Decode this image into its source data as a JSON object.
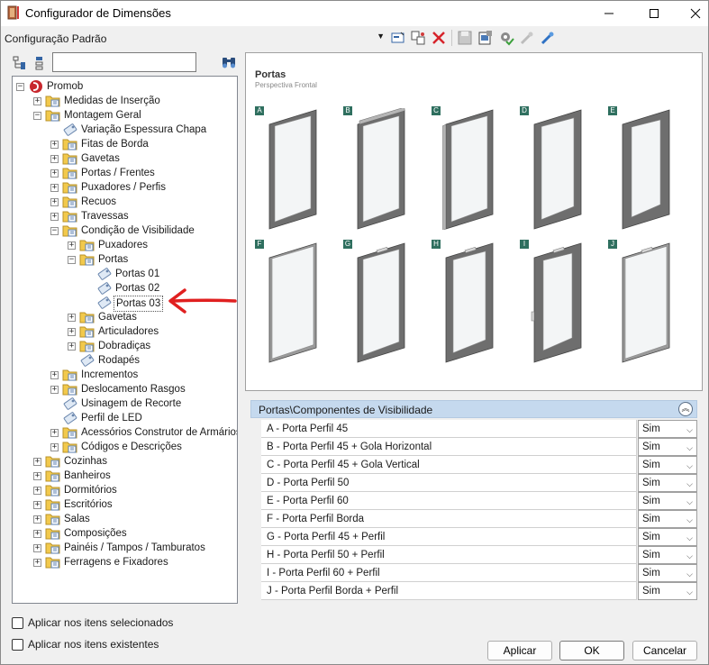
{
  "window": {
    "title": "Configurador de Dimensões"
  },
  "toolbar": {
    "config_value": "Configuração Padrão"
  },
  "search": {
    "placeholder": ""
  },
  "tree": [
    {
      "label": "Promob",
      "level": 0,
      "exp": "-",
      "icon": "root"
    },
    {
      "label": "Medidas de Inserção",
      "level": 1,
      "exp": "+",
      "icon": "folder"
    },
    {
      "label": "Montagem Geral",
      "level": 1,
      "exp": "-",
      "icon": "folder"
    },
    {
      "label": "Variação Espessura Chapa",
      "level": 2,
      "exp": "",
      "icon": "leaf"
    },
    {
      "label": "Fitas de Borda",
      "level": 2,
      "exp": "+",
      "icon": "folder"
    },
    {
      "label": "Gavetas",
      "level": 2,
      "exp": "+",
      "icon": "folder"
    },
    {
      "label": "Portas / Frentes",
      "level": 2,
      "exp": "+",
      "icon": "folder"
    },
    {
      "label": "Puxadores / Perfis",
      "level": 2,
      "exp": "+",
      "icon": "folder"
    },
    {
      "label": "Recuos",
      "level": 2,
      "exp": "+",
      "icon": "folder"
    },
    {
      "label": "Travessas",
      "level": 2,
      "exp": "+",
      "icon": "folder"
    },
    {
      "label": "Condição de Visibilidade",
      "level": 2,
      "exp": "-",
      "icon": "folder"
    },
    {
      "label": "Puxadores",
      "level": 3,
      "exp": "+",
      "icon": "folder"
    },
    {
      "label": "Portas",
      "level": 3,
      "exp": "-",
      "icon": "folder"
    },
    {
      "label": "Portas 01",
      "level": 4,
      "exp": "",
      "icon": "leaf"
    },
    {
      "label": "Portas 02",
      "level": 4,
      "exp": "",
      "icon": "leaf"
    },
    {
      "label": "Portas 03",
      "level": 4,
      "exp": "",
      "icon": "leaf",
      "selected": true
    },
    {
      "label": "Gavetas",
      "level": 3,
      "exp": "+",
      "icon": "folder"
    },
    {
      "label": "Articuladores",
      "level": 3,
      "exp": "+",
      "icon": "folder"
    },
    {
      "label": "Dobradiças",
      "level": 3,
      "exp": "+",
      "icon": "folder"
    },
    {
      "label": "Rodapés",
      "level": 3,
      "exp": "",
      "icon": "leaf"
    },
    {
      "label": "Incrementos",
      "level": 2,
      "exp": "+",
      "icon": "folder"
    },
    {
      "label": "Deslocamento Rasgos",
      "level": 2,
      "exp": "+",
      "icon": "folder"
    },
    {
      "label": "Usinagem de Recorte",
      "level": 2,
      "exp": "",
      "icon": "leaf"
    },
    {
      "label": "Perfil de LED",
      "level": 2,
      "exp": "",
      "icon": "leaf"
    },
    {
      "label": "Acessórios Construtor de Armários",
      "level": 2,
      "exp": "+",
      "icon": "folder"
    },
    {
      "label": "Códigos e Descrições",
      "level": 2,
      "exp": "+",
      "icon": "folder"
    },
    {
      "label": "Cozinhas",
      "level": 1,
      "exp": "+",
      "icon": "folder"
    },
    {
      "label": "Banheiros",
      "level": 1,
      "exp": "+",
      "icon": "folder"
    },
    {
      "label": "Dormitórios",
      "level": 1,
      "exp": "+",
      "icon": "folder"
    },
    {
      "label": "Escritórios",
      "level": 1,
      "exp": "+",
      "icon": "folder"
    },
    {
      "label": "Salas",
      "level": 1,
      "exp": "+",
      "icon": "folder"
    },
    {
      "label": "Composições",
      "level": 1,
      "exp": "+",
      "icon": "folder"
    },
    {
      "label": "Painéis / Tampos / Tamburatos",
      "level": 1,
      "exp": "+",
      "icon": "folder"
    },
    {
      "label": "Ferragens e Fixadores",
      "level": 1,
      "exp": "+",
      "icon": "folder"
    }
  ],
  "preview": {
    "title": "Portas",
    "subtitle": "Perspectiva Frontal",
    "doors": [
      "A",
      "B",
      "C",
      "D",
      "E",
      "F",
      "G",
      "H",
      "I",
      "J"
    ]
  },
  "grid": {
    "header": "Portas\\Componentes de Visibilidade",
    "rows": [
      {
        "label": "A - Porta Perfil 45",
        "value": "Sim"
      },
      {
        "label": "B - Porta Perfil 45 + Gola Horizontal",
        "value": "Sim"
      },
      {
        "label": "C - Porta Perfil 45 + Gola Vertical",
        "value": "Sim"
      },
      {
        "label": "D - Porta Perfil 50",
        "value": "Sim"
      },
      {
        "label": "E - Porta Perfil 60",
        "value": "Sim"
      },
      {
        "label": "F - Porta Perfil Borda",
        "value": "Sim"
      },
      {
        "label": "G - Porta Perfil 45 + Perfil",
        "value": "Sim"
      },
      {
        "label": "H - Porta Perfil 50 + Perfil",
        "value": "Sim"
      },
      {
        "label": "I - Porta Perfil 60 + Perfil",
        "value": "Sim"
      },
      {
        "label": "J - Porta Perfil Borda + Perfil",
        "value": "Sim"
      }
    ]
  },
  "options": {
    "apply_selected": "Aplicar nos itens selecionados",
    "apply_existing": "Aplicar nos itens existentes"
  },
  "buttons": {
    "apply": "Aplicar",
    "ok": "OK",
    "cancel": "Cancelar"
  },
  "colors": {
    "tag": "#2f6f5f",
    "grid_header": "#c5d9ee",
    "folder": "#f2c94c"
  }
}
